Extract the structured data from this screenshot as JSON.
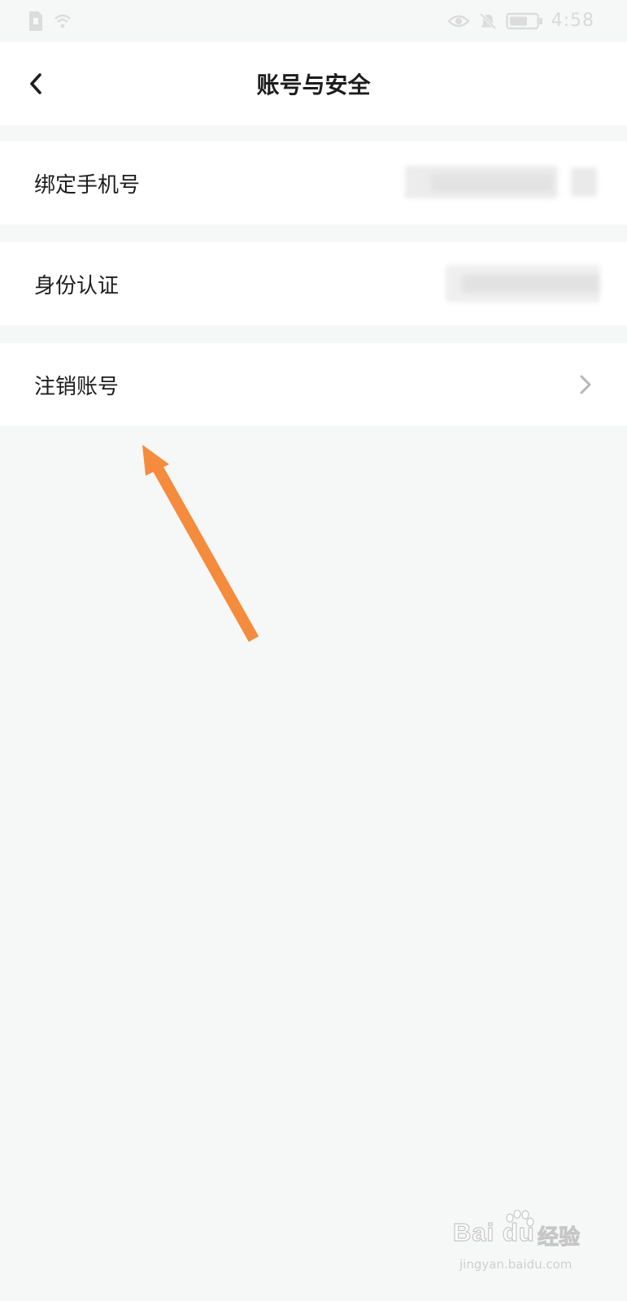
{
  "status_bar": {
    "time": "4:58",
    "icons": [
      "sim-card-icon",
      "wifi-icon",
      "eye-icon",
      "mute-bell-icon",
      "battery-icon"
    ]
  },
  "header": {
    "back_icon": "chevron-left-icon",
    "title": "账号与安全"
  },
  "rows": [
    {
      "label": "绑定手机号",
      "value_hidden": true
    },
    {
      "label": "身份认证",
      "value_hidden": true
    },
    {
      "label": "注销账号",
      "icon": "chevron-right-icon"
    }
  ],
  "annotation": {
    "type": "arrow",
    "color": "#f58b3c",
    "points_to": "注销账号"
  },
  "watermark": {
    "main": "Bai du",
    "cn": "经验",
    "sub": "jingyan.baidu.com"
  },
  "colors": {
    "background": "#f6f7f7",
    "card": "#ffffff",
    "text": "#1d1d1d",
    "chevron": "#b7b7b7",
    "arrow": "#f58b3c"
  }
}
